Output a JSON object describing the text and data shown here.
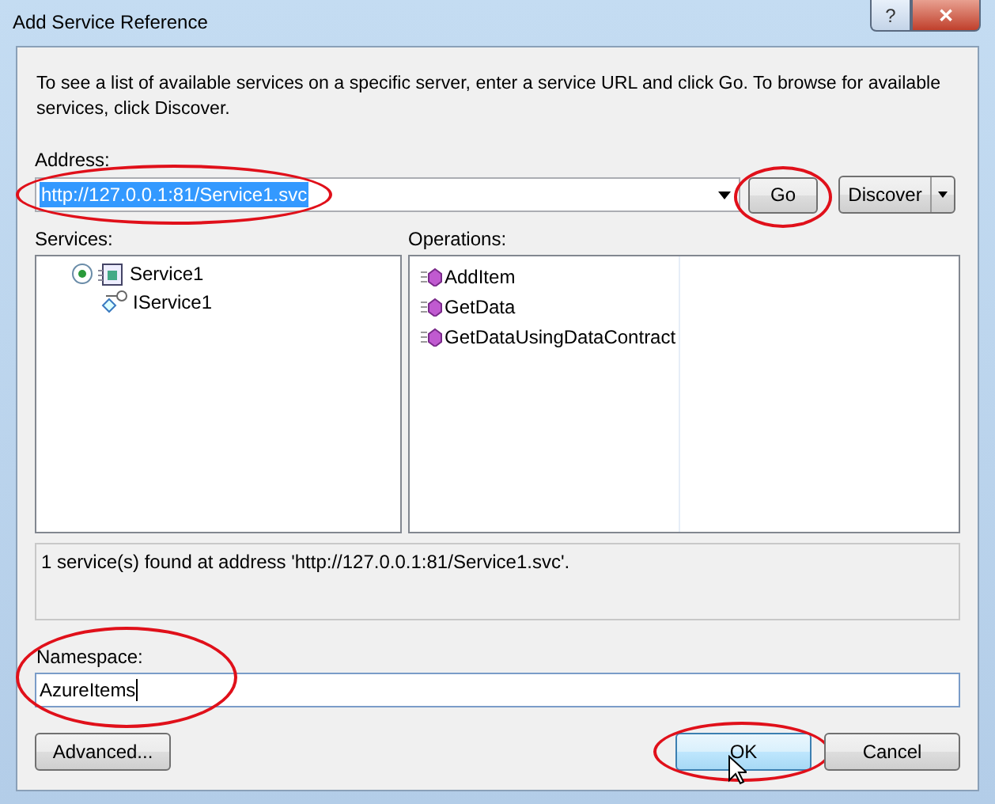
{
  "window": {
    "title": "Add Service Reference",
    "buttons": [
      {
        "kind": "help",
        "label": "?"
      },
      {
        "kind": "close",
        "label": "✕"
      }
    ]
  },
  "instructions": "To see a list of available services on a specific server, enter a service URL and click Go. To browse for available services, click Discover.",
  "address": {
    "label": "Address:",
    "value": "http://127.0.0.1:81/Service1.svc",
    "text_selected": true,
    "highlighted": true
  },
  "go_button": {
    "label": "Go",
    "highlighted": true
  },
  "discover_button": {
    "label": "Discover"
  },
  "services": {
    "label": "Services:",
    "items": [
      {
        "name": "Service1",
        "kind": "service",
        "children": [
          {
            "name": "IService1",
            "kind": "contract"
          }
        ]
      }
    ]
  },
  "operations": {
    "label": "Operations:",
    "items": [
      "AddItem",
      "GetData",
      "GetDataUsingDataContract"
    ]
  },
  "status": "1 service(s) found at address 'http://127.0.0.1:81/Service1.svc'.",
  "namespace": {
    "label": "Namespace:",
    "value": "AzureItems",
    "highlighted": true
  },
  "buttons": [
    {
      "label": "Advanced...",
      "hovered": false,
      "highlighted": false
    },
    {
      "label": "OK",
      "hovered": true,
      "highlighted": true
    },
    {
      "label": "Cancel",
      "hovered": false,
      "highlighted": false
    }
  ]
}
